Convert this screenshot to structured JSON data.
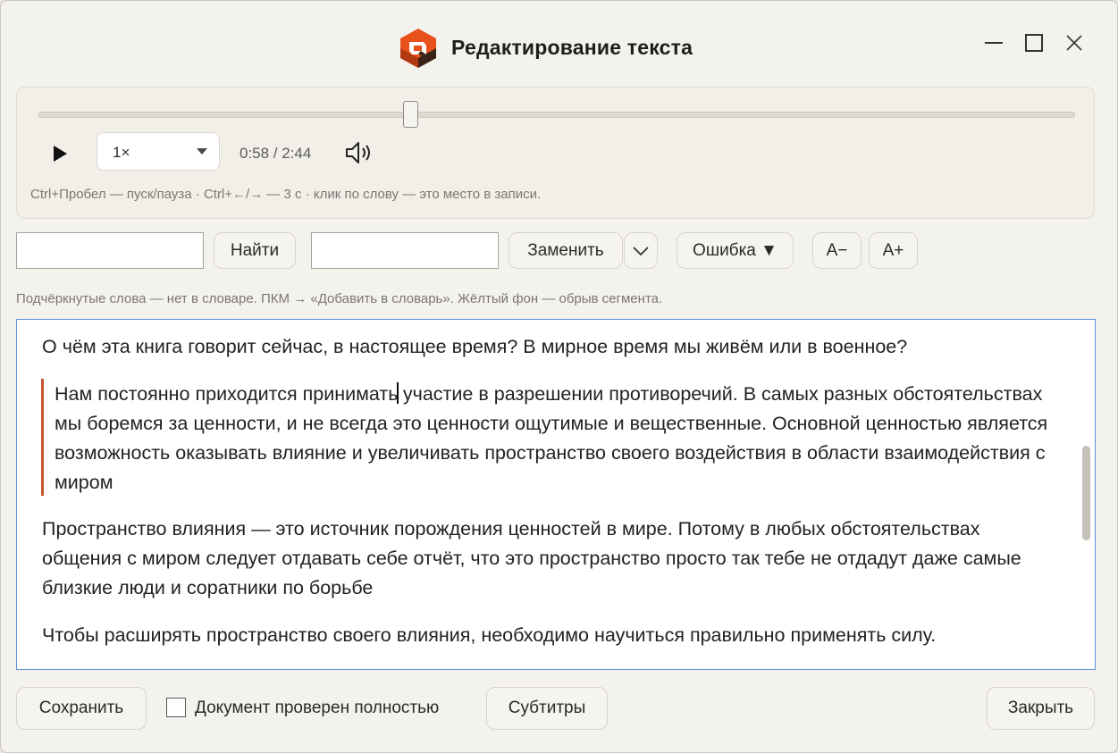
{
  "window": {
    "title": "Редактирование текста",
    "controls": {
      "minimize": "minimize-icon",
      "maximize": "maximize-icon",
      "close": "close-icon"
    }
  },
  "player": {
    "progress_fraction": 0.36,
    "speed": "1×",
    "time": "0:58 / 2:44",
    "hint": "Ctrl+Пробел — пуск/пауза · Ctrl+←/→ — 3 с · клик по слову — это место в записи."
  },
  "toolbar": {
    "find_value": "",
    "find_label": "Найти",
    "replace_value": "",
    "replace_label": "Заменить",
    "error_label": "Ошибка ▼",
    "font_smaller": "A−",
    "font_larger": "A+"
  },
  "info_hint": "Подчёркнутые слова — нет в словаре. ПКМ → «Добавить в словарь». Жёлтый фон — обрыв сегмента.",
  "editor": {
    "paragraphs": [
      "О чём эта книга говорит сейчас, в настоящее время? В мирное время мы живём или в военное?",
      "Нам постоянно приходится принимать участие в разрешении противоречий. В самых разных обстоятельствах мы боремся за ценности, и не всегда это ценности ощутимые и вещественные. Основной ценностью является возможность оказывать влияние и увеличивать пространство своего воздействия в области взаимодействия с миром",
      "Пространство влияния — это источник порождения ценностей в мире. Потому в любых обстоятельствах общения с миром следует отдавать себе отчёт, что это пространство просто так тебе не отдадут даже самые близкие люди и соратники по борьбе",
      "Чтобы расширять пространство своего влияния, необходимо научиться правильно применять силу."
    ],
    "caret_split": [
      "Нам постоянно приходится принимать",
      " участие в разрешении противоречий. В самых разных обстоятельствах мы боремся за ценности, и не всегда это ценности ощутимые и вещественные. Основной ценностью является возможность оказывать влияние и увеличивать пространство своего воздействия в области взаимодействия с миром"
    ],
    "accent_color": "#c3542c"
  },
  "footer": {
    "save": "Сохранить",
    "checkbox_label": "Документ проверен полностью",
    "checked": false,
    "subtitles": "Субтитры",
    "close": "Закрыть"
  },
  "colors": {
    "focus_border": "#5d8fd9",
    "logo_orange": "#e8501c",
    "logo_dark": "#3a2418"
  }
}
